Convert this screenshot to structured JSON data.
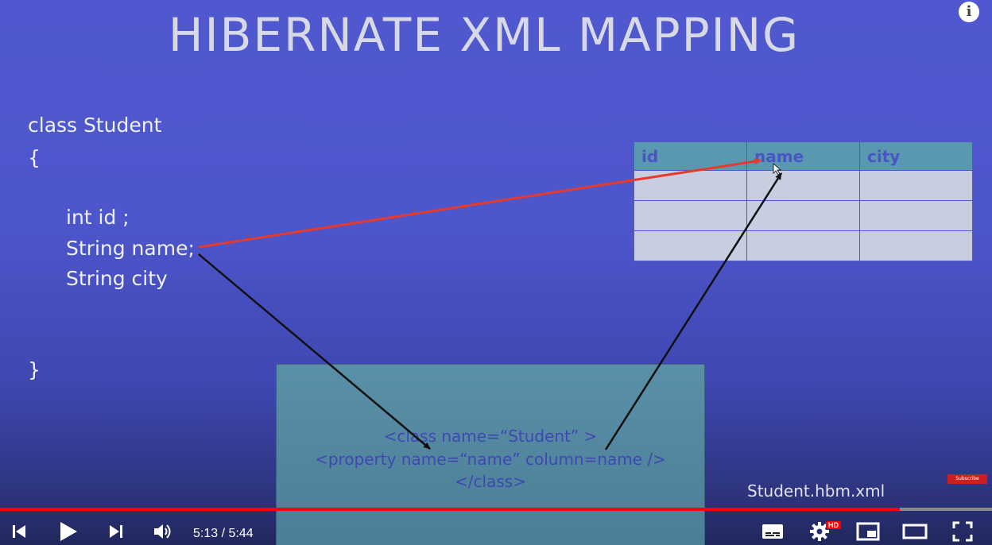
{
  "slide": {
    "title": "HIBERNATE XML MAPPING",
    "code": {
      "line1": "class Student",
      "line2": "{",
      "line3": "int id ;",
      "line4": "String name;",
      "line5": "String city",
      "line6": "}"
    },
    "table": {
      "headers": [
        "id",
        "name",
        "city"
      ],
      "empty_rows": 3
    },
    "xml": {
      "line1": "<class name=“Student” >",
      "line2": "<property name=“name” column=name />",
      "line3": "</class>"
    },
    "file_label": "Student.hbm.xml",
    "subscribe_label": "Subscribe",
    "arrow_colors": {
      "red": "#e53a2c",
      "black": "#111111"
    }
  },
  "player": {
    "time_current": "5:13",
    "time_total": "5:44",
    "time_display": "5:13 / 5:44",
    "progress_fraction": 0.907,
    "hd_badge": "HD",
    "icons": [
      "previous-icon",
      "play-icon",
      "next-icon",
      "volume-icon",
      "subtitles-icon",
      "settings-icon",
      "miniplayer-icon",
      "theater-mode-icon",
      "fullscreen-icon"
    ]
  },
  "colors": {
    "progress_played": "#ff0000",
    "progress_bg": "#8a8a8a"
  }
}
